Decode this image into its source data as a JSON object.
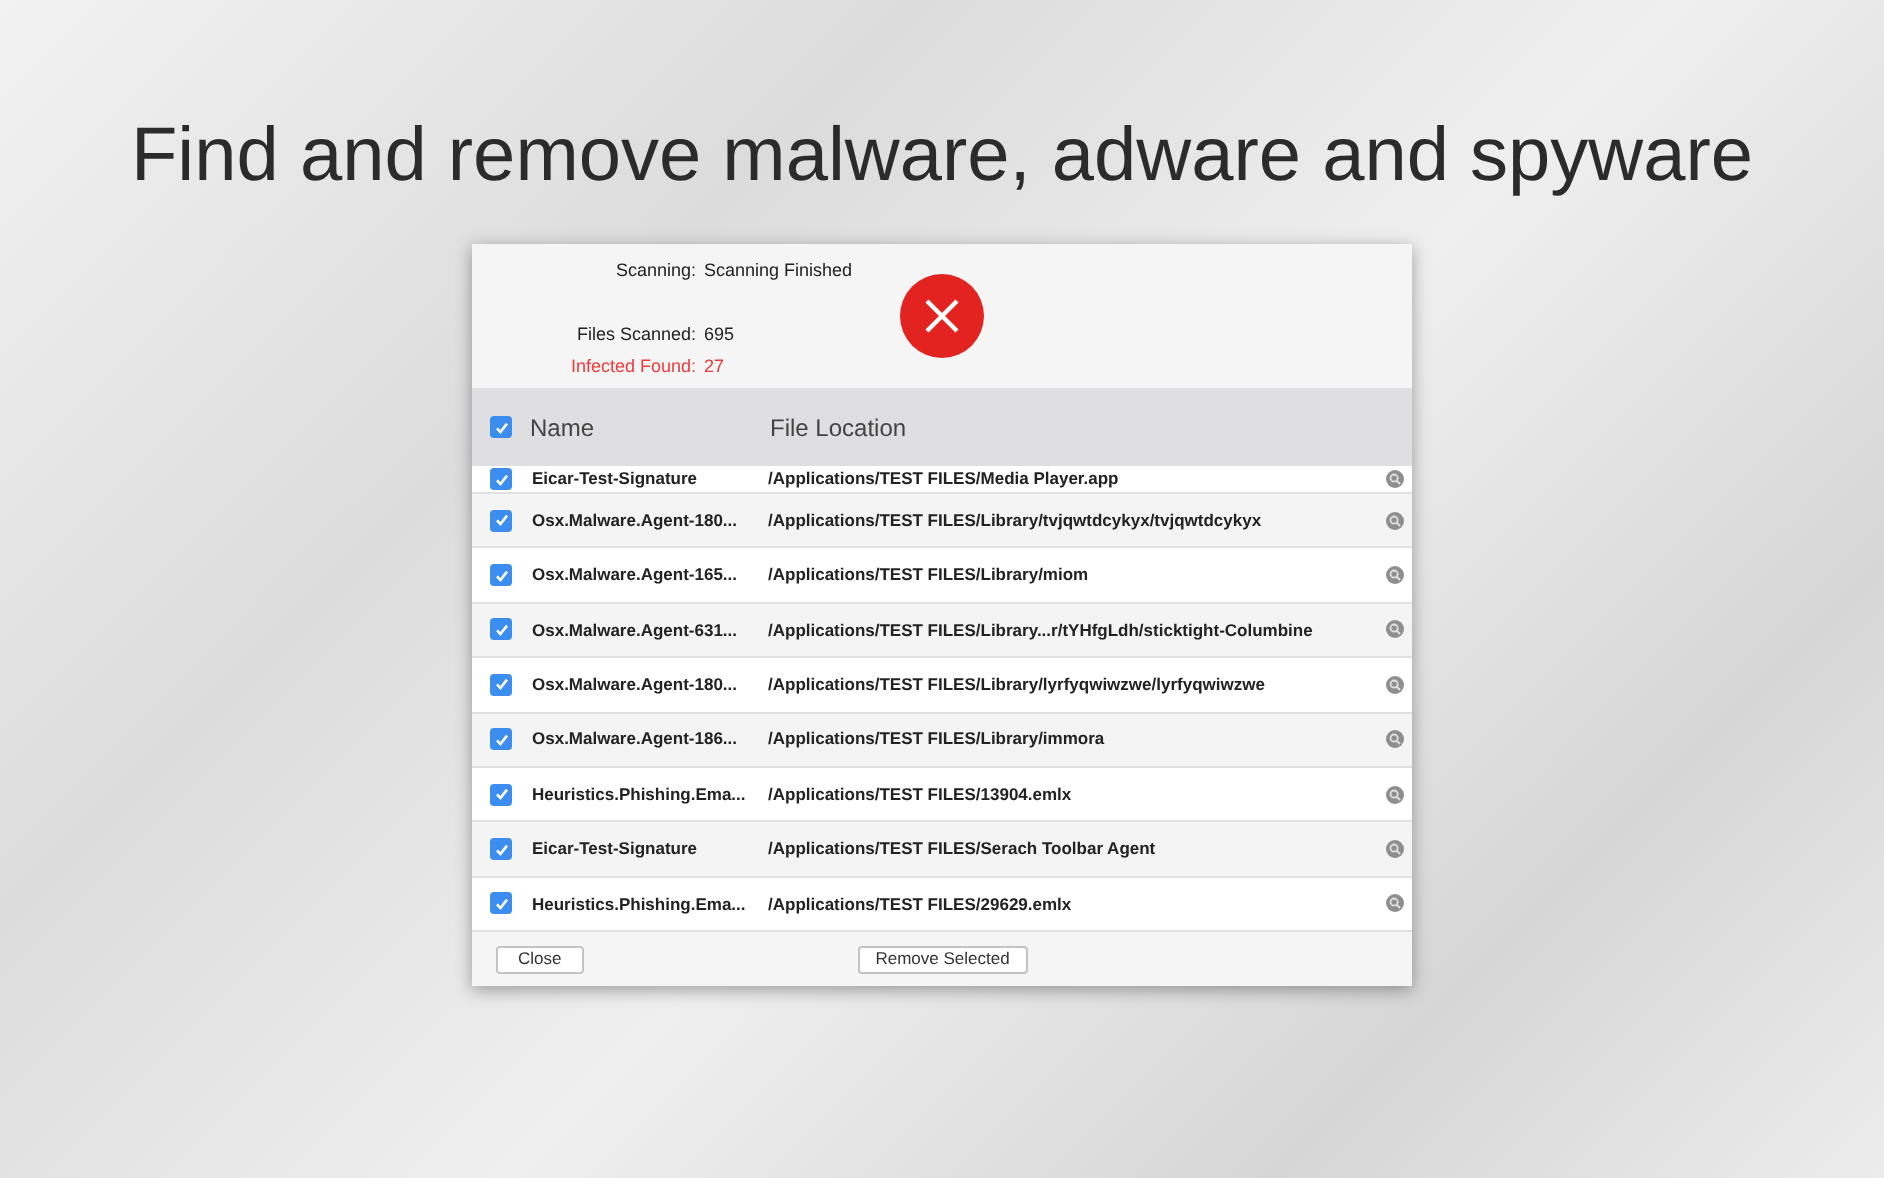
{
  "headline": "Find and remove malware, adware and spyware",
  "summary": {
    "scanning_label": "Scanning:",
    "scanning_value": "Scanning Finished",
    "files_label": "Files Scanned:",
    "files_value": "695",
    "infected_label": "Infected Found:",
    "infected_value": "27"
  },
  "table": {
    "select_all": {
      "checked": true
    },
    "columns": [
      "Name",
      "File Location"
    ],
    "rows": [
      {
        "name": "Eicar-Test-Signature",
        "location": "/Applications/TEST FILES/Media Player.app",
        "checked": true
      },
      {
        "name": "Osx.Malware.Agent-180...",
        "location": "/Applications/TEST FILES/Library/tvjqwtdcykyx/tvjqwtdcykyx",
        "checked": true
      },
      {
        "name": "Osx.Malware.Agent-165...",
        "location": "/Applications/TEST FILES/Library/miom",
        "checked": true
      },
      {
        "name": "Osx.Malware.Agent-631...",
        "location": "/Applications/TEST FILES/Library...r/tYHfgLdh/sticktight-Columbine",
        "checked": true
      },
      {
        "name": "Osx.Malware.Agent-180...",
        "location": "/Applications/TEST FILES/Library/lyrfyqwiwzwe/lyrfyqwiwzwe",
        "checked": true
      },
      {
        "name": "Osx.Malware.Agent-186...",
        "location": "/Applications/TEST FILES/Library/immora",
        "checked": true
      },
      {
        "name": "Heuristics.Phishing.Ema...",
        "location": "/Applications/TEST FILES/13904.emlx",
        "checked": true
      },
      {
        "name": "Eicar-Test-Signature",
        "location": "/Applications/TEST FILES/Serach Toolbar Agent",
        "checked": true
      },
      {
        "name": "Heuristics.Phishing.Ema...",
        "location": "/Applications/TEST FILES/29629.emlx",
        "checked": true
      }
    ]
  },
  "buttons": {
    "close": "Close",
    "remove": "Remove Selected"
  }
}
